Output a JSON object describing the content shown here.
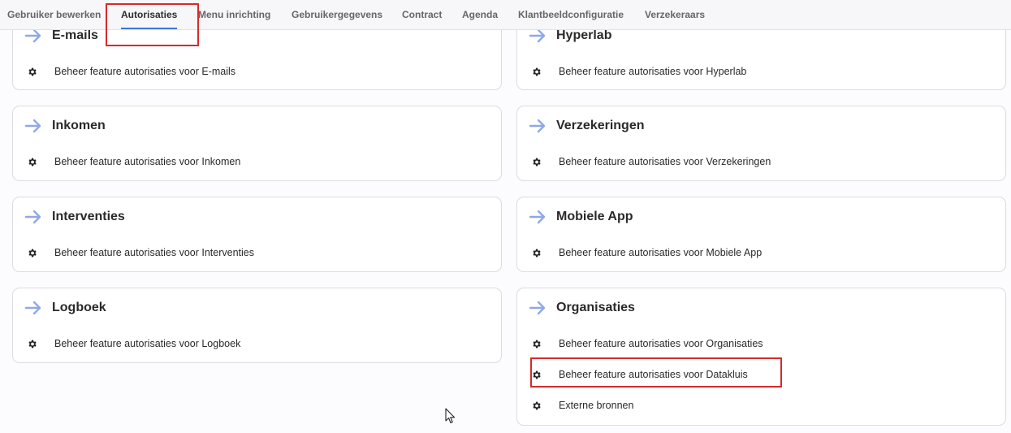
{
  "tabs": [
    {
      "label": "Gebruiker bewerken"
    },
    {
      "label": "Autorisaties"
    },
    {
      "label": "Menu inrichting"
    },
    {
      "label": "Gebruikergegevens"
    },
    {
      "label": "Contract"
    },
    {
      "label": "Agenda"
    },
    {
      "label": "Klantbeeldconfiguratie"
    },
    {
      "label": "Verzekeraars"
    }
  ],
  "active_tab": "Autorisaties",
  "accent_color": "#3f78d8",
  "arrow_color": "#8fa8e8",
  "highlight_color": "#d62a2a",
  "cards": [
    {
      "title": "E-mails",
      "items": [
        "Beheer feature autorisaties voor E-mails"
      ]
    },
    {
      "title": "Hyperlab",
      "items": [
        "Beheer feature autorisaties voor Hyperlab"
      ]
    },
    {
      "title": "Inkomen",
      "items": [
        "Beheer feature autorisaties voor Inkomen"
      ]
    },
    {
      "title": "Verzekeringen",
      "items": [
        "Beheer feature autorisaties voor Verzekeringen"
      ]
    },
    {
      "title": "Interventies",
      "items": [
        "Beheer feature autorisaties voor Interventies"
      ]
    },
    {
      "title": "Mobiele App",
      "items": [
        "Beheer feature autorisaties voor Mobiele App"
      ]
    },
    {
      "title": "Logboek",
      "items": [
        "Beheer feature autorisaties voor Logboek"
      ]
    },
    {
      "title": "Organisaties",
      "items": [
        "Beheer feature autorisaties voor Organisaties",
        "Beheer feature autorisaties voor Datakluis",
        "Externe bronnen"
      ]
    }
  ],
  "icons": {
    "card": "arrow-right-icon",
    "item": "gear-icon"
  }
}
